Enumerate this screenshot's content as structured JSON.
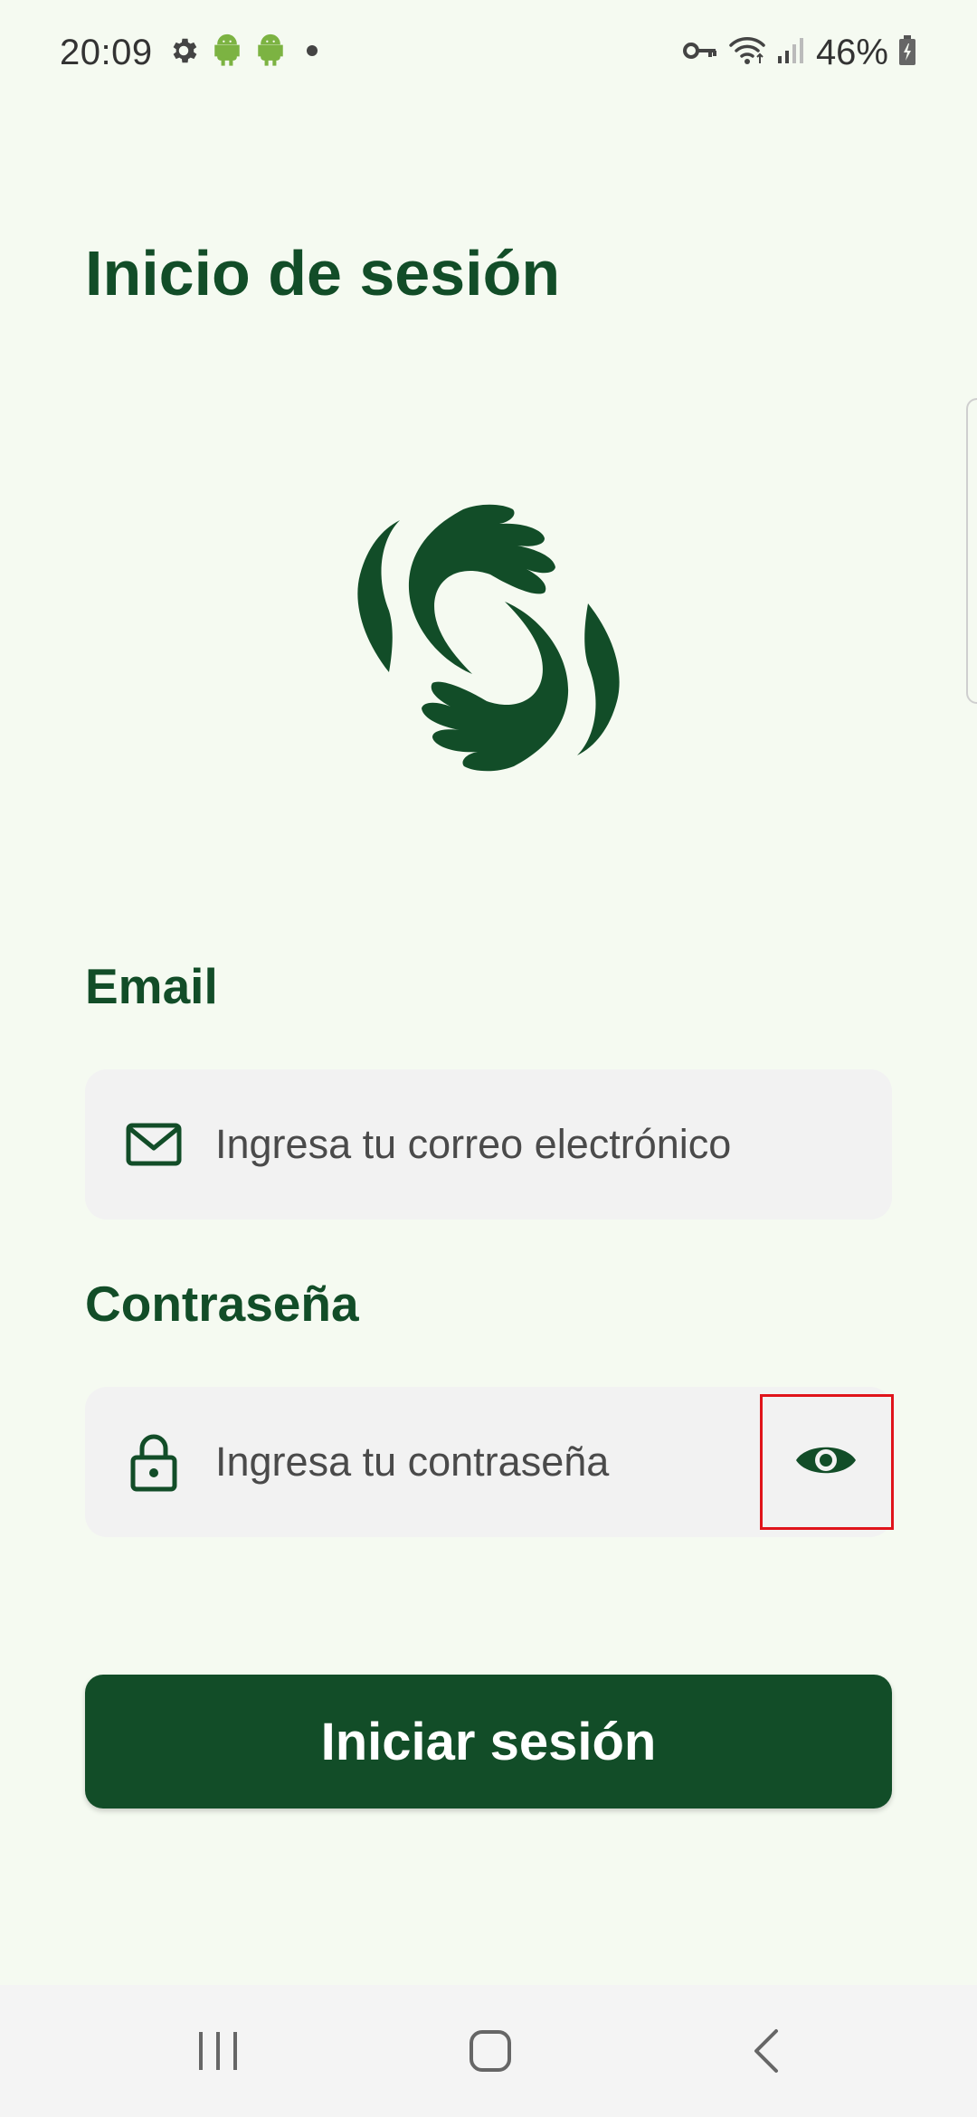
{
  "status_bar": {
    "time": "20:09",
    "battery": "46%",
    "icons": [
      "gear-icon",
      "android-icon",
      "android-icon",
      "notification-dot-icon",
      "vpn-key-icon",
      "wifi-icon",
      "signal-icon",
      "battery-charging-icon"
    ]
  },
  "page": {
    "title": "Inicio de sesión"
  },
  "logo": {
    "icon": "hands-logo-icon"
  },
  "email": {
    "label": "Email",
    "placeholder": "Ingresa tu correo electrónico",
    "value": "",
    "icon": "mail-icon"
  },
  "password": {
    "label": "Contraseña",
    "placeholder": "Ingresa tu contraseña",
    "value": "",
    "icon": "lock-icon",
    "toggle_icon": "eye-icon"
  },
  "login_button": {
    "label": "Iniciar sesión"
  },
  "nav": {
    "recent_icon": "recent-apps-icon",
    "home_icon": "home-icon",
    "back_icon": "back-icon"
  },
  "colors": {
    "brand": "#124d28",
    "background": "#f5faf1",
    "input_bg": "#f2f2f2",
    "highlight": "#e0141b"
  }
}
